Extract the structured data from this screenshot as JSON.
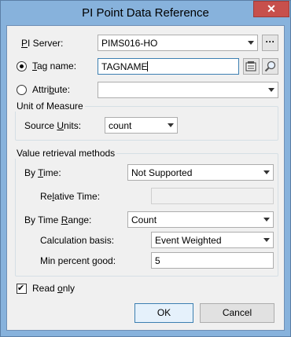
{
  "window": {
    "title": "PI Point Data Reference",
    "close_glyph": "✕"
  },
  "pi_server": {
    "label_pre": "",
    "label_u": "P",
    "label_post": "I Server:",
    "value": "PIMS016-HO",
    "more_label": "···"
  },
  "tag_name": {
    "label_pre": "",
    "label_u": "T",
    "label_post": "ag name:",
    "value": "TAGNAME",
    "selected": true
  },
  "attribute": {
    "label_pre": "Attri",
    "label_u": "b",
    "label_post": "ute:",
    "value": "",
    "selected": false
  },
  "unit_of_measure": {
    "group_title": "Unit of Measure",
    "source_units_label_pre": "Source ",
    "source_units_label_u": "U",
    "source_units_label_post": "nits:",
    "source_units_value": "count"
  },
  "value_retrieval": {
    "group_title": "Value retrieval methods",
    "by_time_label_pre": "By ",
    "by_time_label_u": "T",
    "by_time_label_post": "ime:",
    "by_time_value": "Not Supported",
    "relative_time_label_pre": "Re",
    "relative_time_label_u": "l",
    "relative_time_label_post": "ative Time:",
    "relative_time_value": "",
    "by_time_range_label_pre": "By Time ",
    "by_time_range_label_u": "R",
    "by_time_range_label_post": "ange:",
    "by_time_range_value": "Count",
    "calc_basis_label": "Calculation basis:",
    "calc_basis_value": "Event Weighted",
    "min_percent_label": "Min percent good:",
    "min_percent_value": "5"
  },
  "read_only": {
    "label_pre": "Read ",
    "label_u": "o",
    "label_post": "nly",
    "checked": true,
    "check_glyph": "✔"
  },
  "buttons": {
    "ok": "OK",
    "cancel": "Cancel"
  },
  "icons": {
    "tag_search": "tag-search-icon",
    "magnifier": "magnifier-icon"
  },
  "colors": {
    "titlebar": "#87b2dc",
    "close": "#c7504c",
    "focus": "#3c7fb1"
  }
}
